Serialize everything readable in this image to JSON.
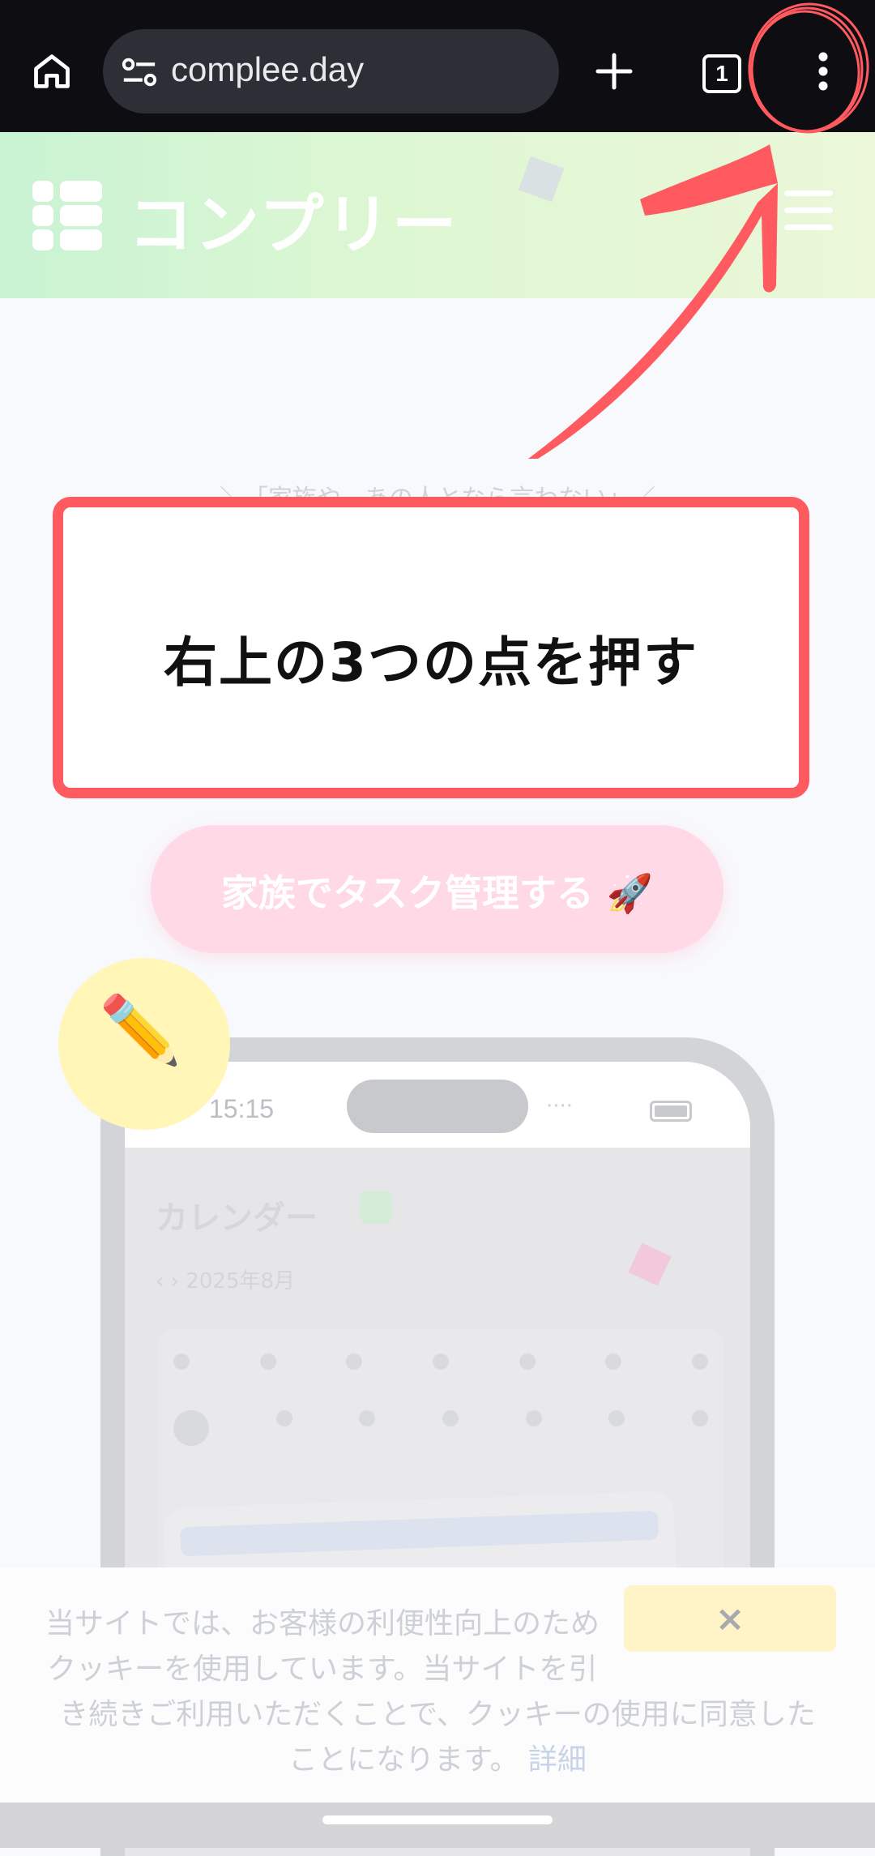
{
  "browser": {
    "url": "complee.day",
    "tab_count": "1"
  },
  "site": {
    "logo_text": "コンプリー"
  },
  "hero": {
    "subtitle": "＼「家族や、あの人となら言わない」／",
    "cta_label": "家族でタスク管理する 🚀",
    "pencil_icon": "✏️"
  },
  "phone": {
    "time": "15:15",
    "signal": "····",
    "calendar_title": "カレンダー",
    "calendar_sub": "‹   ›   2025年8月"
  },
  "cookie": {
    "line1": "当サイトでは、お客様の利便性向上のため",
    "line2": "クッキーを使用しています。当サイトを引",
    "line3": "き続きご利用いただくことで、クッキーの使用に同意した",
    "line4_text": "ことになります。",
    "link": "詳細",
    "close_label": "×"
  },
  "annotation": {
    "instruction": "右上の3つの点を押す",
    "accent_color": "#ff5a5f"
  }
}
